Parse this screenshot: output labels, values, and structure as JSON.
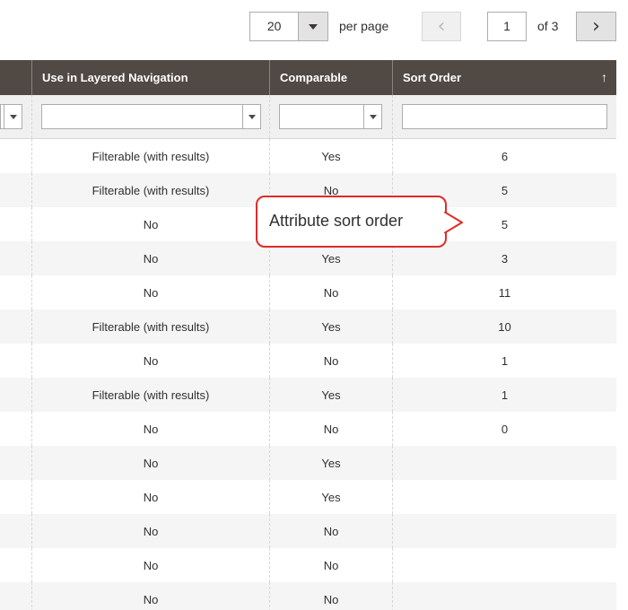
{
  "pager": {
    "per_page_value": "20",
    "per_page_label": "per page",
    "current_page": "1",
    "total_pages_label": "of 3",
    "prev_icon": "chevron-left-icon",
    "next_icon": "chevron-right-icon"
  },
  "grid": {
    "columns": [
      "",
      "Use in Layered Navigation",
      "Comparable",
      "Sort Order"
    ],
    "sort_indicator": "↑",
    "rows": [
      {
        "layered": "Filterable (with results)",
        "comparable": "Yes",
        "sort": "6"
      },
      {
        "layered": "Filterable (with results)",
        "comparable": "No",
        "sort": "5"
      },
      {
        "layered": "No",
        "comparable": "",
        "sort": "5"
      },
      {
        "layered": "No",
        "comparable": "Yes",
        "sort": "3"
      },
      {
        "layered": "No",
        "comparable": "No",
        "sort": "11"
      },
      {
        "layered": "Filterable (with results)",
        "comparable": "Yes",
        "sort": "10"
      },
      {
        "layered": "No",
        "comparable": "No",
        "sort": "1"
      },
      {
        "layered": "Filterable (with results)",
        "comparable": "Yes",
        "sort": "1"
      },
      {
        "layered": "No",
        "comparable": "No",
        "sort": "0"
      },
      {
        "layered": "No",
        "comparable": "Yes",
        "sort": ""
      },
      {
        "layered": "No",
        "comparable": "Yes",
        "sort": ""
      },
      {
        "layered": "No",
        "comparable": "No",
        "sort": ""
      },
      {
        "layered": "No",
        "comparable": "No",
        "sort": ""
      },
      {
        "layered": "No",
        "comparable": "No",
        "sort": ""
      }
    ]
  },
  "callout": {
    "text": "Attribute sort order"
  },
  "colors": {
    "header_bg": "#514943",
    "callout_border": "#e02b27"
  }
}
